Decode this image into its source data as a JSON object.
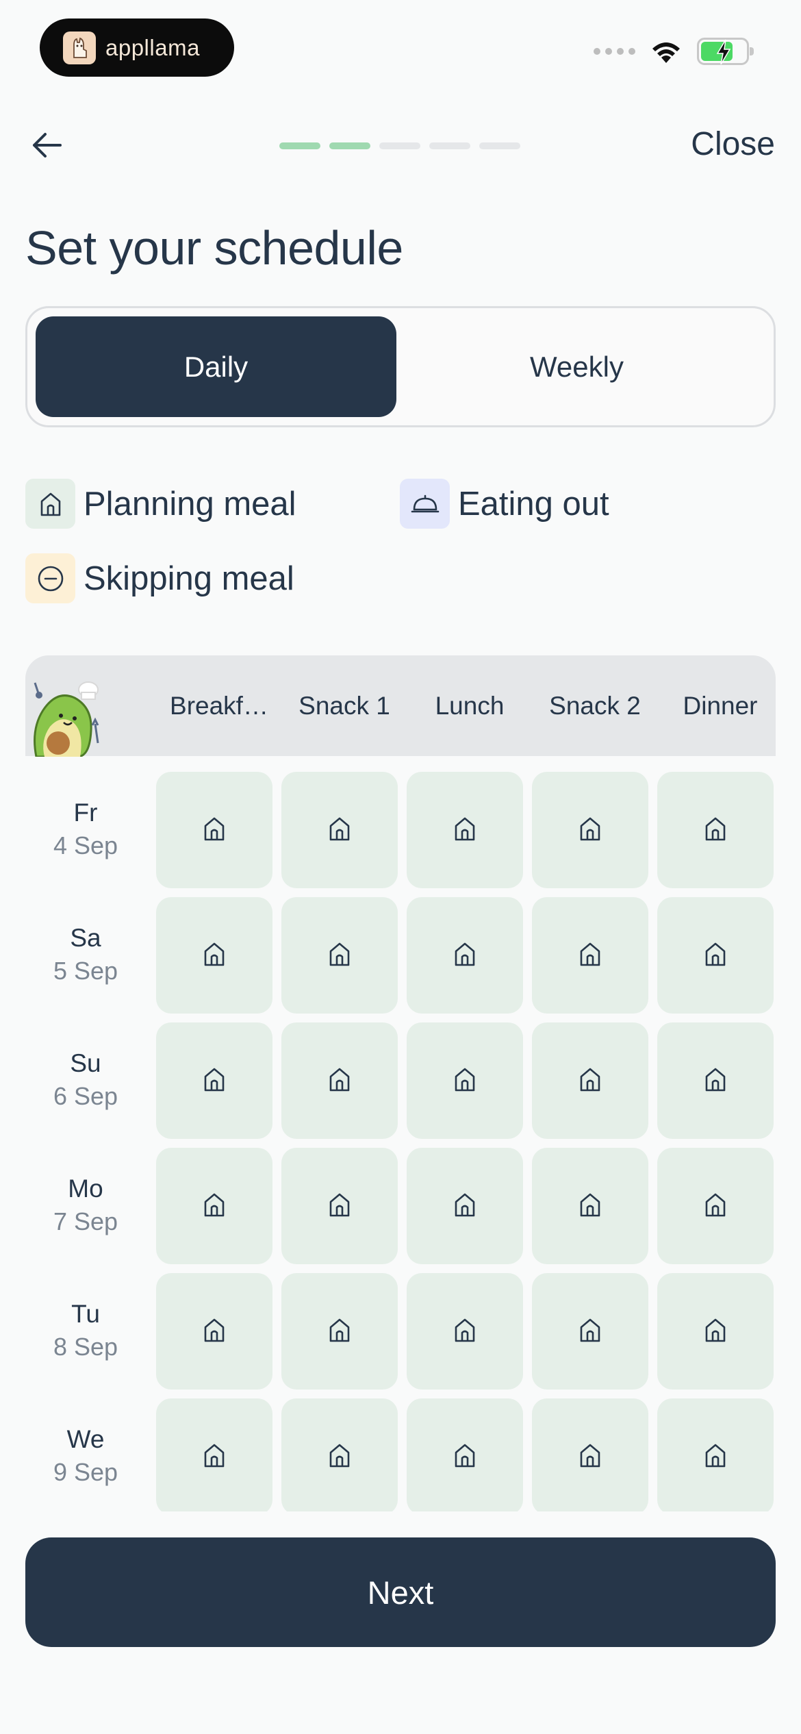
{
  "status_bar": {
    "app_name": "appllama"
  },
  "header": {
    "close_label": "Close",
    "progress_steps": 5,
    "progress_completed": 2,
    "progress_active_color": "#9fd9b0",
    "progress_inactive_color": "#e5e7e9"
  },
  "title": "Set your schedule",
  "toggle": {
    "daily_label": "Daily",
    "weekly_label": "Weekly",
    "selected": "Daily"
  },
  "legend": {
    "planning": "Planning meal",
    "eating_out": "Eating out",
    "skipping": "Skipping meal"
  },
  "table": {
    "columns": [
      "Breakf…",
      "Snack 1",
      "Lunch",
      "Snack 2",
      "Dinner"
    ],
    "rows": [
      {
        "day": "Fr",
        "date": "4 Sep"
      },
      {
        "day": "Sa",
        "date": "5 Sep"
      },
      {
        "day": "Su",
        "date": "6 Sep"
      },
      {
        "day": "Mo",
        "date": "7 Sep"
      },
      {
        "day": "Tu",
        "date": "8 Sep"
      },
      {
        "day": "We",
        "date": "9 Sep"
      }
    ],
    "cell_state": "planning"
  },
  "next_label": "Next",
  "colors": {
    "primary": "#263649",
    "planning_bg": "#e5efe8",
    "eating_out_bg": "#e3e7fb",
    "skipping_bg": "#fdf0d6"
  }
}
